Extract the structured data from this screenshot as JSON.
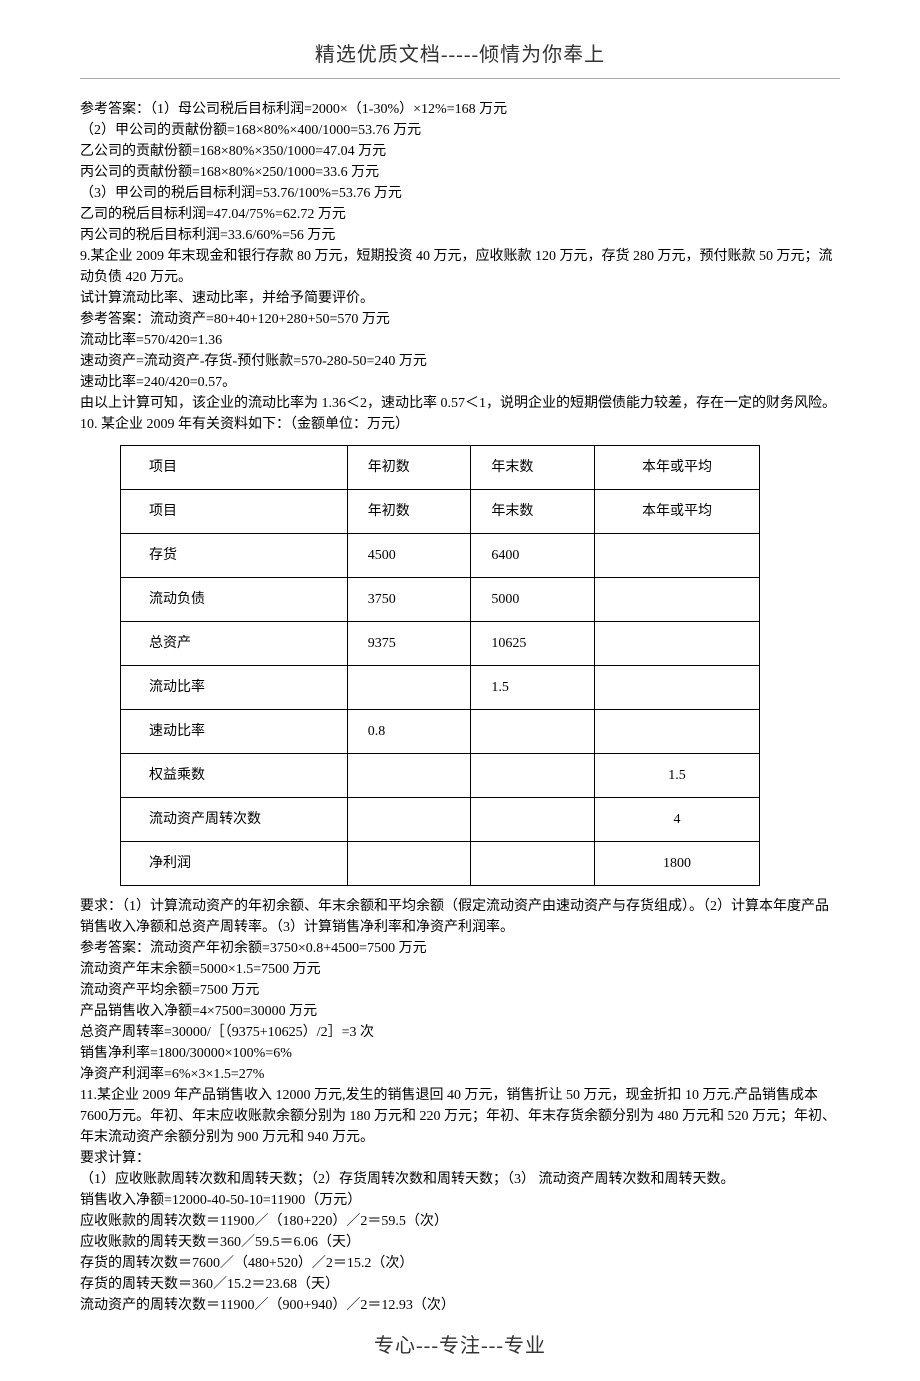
{
  "header": "精选优质文档-----倾情为你奉上",
  "lines_top": [
    "参考答案：（1）母公司税后目标利润=2000×（1-30%）×12%=168 万元",
    "（2）甲公司的贡献份额=168×80%×400/1000=53.76 万元",
    "乙公司的贡献份额=168×80%×350/1000=47.04 万元",
    "丙公司的贡献份额=168×80%×250/1000=33.6 万元",
    "（3）甲公司的税后目标利润=53.76/100%=53.76 万元",
    "乙司的税后目标利润=47.04/75%=62.72 万元",
    "丙公司的税后目标利润=33.6/60%=56 万元",
    "9.某企业 2009 年末现金和银行存款 80 万元，短期投资 40 万元，应收账款 120 万元，存货 280 万元，预付账款 50 万元；流动负债 420 万元。",
    "试计算流动比率、速动比率，并给予简要评价。",
    "参考答案：流动资产=80+40+120+280+50=570 万元",
    "流动比率=570/420=1.36",
    "速动资产=流动资产-存货-预付账款=570-280-50=240 万元",
    "速动比率=240/420=0.57。",
    "由以上计算可知，该企业的流动比率为 1.36＜2，速动比率 0.57＜1，说明企业的短期偿债能力较差，存在一定的财务风险。",
    "10. 某企业 2009 年有关资料如下：（金额单位：万元）"
  ],
  "table": {
    "rows": [
      [
        "项目",
        "年初数",
        "年末数",
        "本年或平均"
      ],
      [
        "项目",
        "年初数",
        "年末数",
        "本年或平均"
      ],
      [
        "存货",
        "4500",
        "6400",
        ""
      ],
      [
        "流动负债",
        "3750",
        "5000",
        ""
      ],
      [
        "总资产",
        "9375",
        "10625",
        ""
      ],
      [
        "流动比率",
        "",
        "1.5",
        ""
      ],
      [
        "速动比率",
        "0.8",
        "",
        ""
      ],
      [
        "权益乘数",
        "",
        "",
        "1.5"
      ],
      [
        "流动资产周转次数",
        "",
        "",
        "4"
      ],
      [
        "净利润",
        "",
        "",
        "1800"
      ]
    ]
  },
  "lines_bottom": [
    "要求：（1）计算流动资产的年初余额、年末余额和平均余额（假定流动资产由速动资产与存货组成）。（2）计算本年度产品销售收入净额和总资产周转率。（3）计算销售净利率和净资产利润率。",
    "参考答案：流动资产年初余额=3750×0.8+4500=7500 万元",
    "流动资产年末余额=5000×1.5=7500 万元",
    "流动资产平均余额=7500 万元",
    "产品销售收入净额=4×7500=30000 万元",
    "总资产周转率=30000/［（9375+10625）/2］=3 次",
    "销售净利率=1800/30000×100%=6%",
    "净资产利润率=6%×3×1.5=27%",
    "11.某企业 2009 年产品销售收入 12000 万元,发生的销售退回 40 万元，销售折让 50 万元，现金折扣 10 万元.产品销售成本 7600万元。年初、年末应收账款余额分别为 180 万元和 220 万元；年初、年末存货余额分别为 480 万元和 520 万元；年初、年末流动资产余额分别为 900 万元和 940 万元。",
    "要求计算：",
    "（1）应收账款周转次数和周转天数；（2）存货周转次数和周转天数；（3） 流动资产周转次数和周转天数。",
    "销售收入净额=12000-40-50-10=11900（万元）",
    "应收账款的周转次数＝11900／（180+220）／2＝59.5（次）",
    "应收账款的周转天数＝360／59.5＝6.06（天）",
    "存货的周转次数＝7600／（480+520）／2＝15.2（次）",
    "存货的周转天数＝360／15.2＝23.68（天）",
    "流动资产的周转次数＝11900／（900+940）／2＝12.93（次）"
  ],
  "footer": "专心---专注---专业"
}
